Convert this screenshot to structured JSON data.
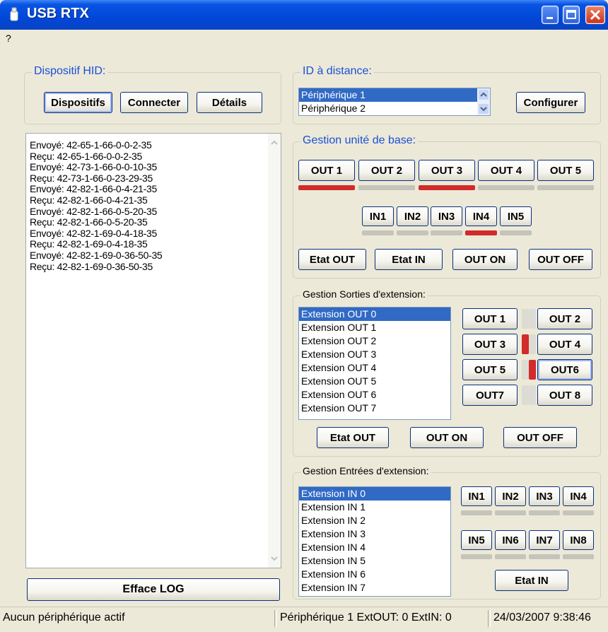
{
  "window": {
    "title": "USB RTX"
  },
  "menu": {
    "help": "?"
  },
  "hid": {
    "title": "Dispositif HID:",
    "devices_btn": "Dispositifs",
    "connect_btn": "Connecter",
    "details_btn": "Détails"
  },
  "remote": {
    "title": "ID à distance:",
    "options": [
      "Périphérique 1",
      "Périphérique 2"
    ],
    "selected": "Périphérique 1",
    "configure_btn": "Configurer"
  },
  "base": {
    "title": "Gestion unité de base:",
    "outs": [
      {
        "label": "OUT 1",
        "active": true
      },
      {
        "label": "OUT 2",
        "active": false
      },
      {
        "label": "OUT 3",
        "active": true
      },
      {
        "label": "OUT 4",
        "active": false
      },
      {
        "label": "OUT 5",
        "active": false
      }
    ],
    "ins": [
      {
        "label": "IN1",
        "active": false
      },
      {
        "label": "IN2",
        "active": false
      },
      {
        "label": "IN3",
        "active": false
      },
      {
        "label": "IN4",
        "active": true
      },
      {
        "label": "IN5",
        "active": false
      }
    ],
    "etat_out_btn": "Etat OUT",
    "etat_in_btn": "Etat IN",
    "out_on_btn": "OUT ON",
    "out_off_btn": "OUT OFF"
  },
  "ext_out": {
    "title": "Gestion Sorties d'extension:",
    "list": [
      "Extension OUT 0",
      "Extension OUT 1",
      "Extension OUT 2",
      "Extension OUT 3",
      "Extension OUT 4",
      "Extension OUT 5",
      "Extension OUT 6",
      "Extension OUT 7"
    ],
    "selected": "Extension OUT 0",
    "outs": [
      {
        "label": "OUT 1",
        "active": false
      },
      {
        "label": "OUT 2",
        "active": false
      },
      {
        "label": "OUT 3",
        "active": true
      },
      {
        "label": "OUT 4",
        "active": false
      },
      {
        "label": "OUT 5",
        "active": false
      },
      {
        "label": "OUT6",
        "active": true
      },
      {
        "label": "OUT7",
        "active": false
      },
      {
        "label": "OUT 8",
        "active": false
      }
    ],
    "etat_out_btn": "Etat OUT",
    "out_on_btn": "OUT ON",
    "out_off_btn": "OUT OFF"
  },
  "ext_in": {
    "title": "Gestion Entrées d'extension:",
    "list": [
      "Extension IN 0",
      "Extension IN 1",
      "Extension IN 2",
      "Extension IN 3",
      "Extension IN 4",
      "Extension IN 5",
      "Extension IN 6",
      "Extension IN 7"
    ],
    "selected": "Extension IN 0",
    "ins": [
      {
        "label": "IN1",
        "active": false
      },
      {
        "label": "IN2",
        "active": false
      },
      {
        "label": "IN3",
        "active": false
      },
      {
        "label": "IN4",
        "active": false
      },
      {
        "label": "IN5",
        "active": false
      },
      {
        "label": "IN6",
        "active": false
      },
      {
        "label": "IN7",
        "active": false
      },
      {
        "label": "IN8",
        "active": false
      }
    ],
    "etat_in_btn": "Etat IN"
  },
  "log": {
    "lines": [
      "Envoyé: 42-65-1-66-0-0-2-35",
      "Reçu: 42-65-1-66-0-0-2-35",
      "Envoyé: 42-73-1-66-0-0-10-35",
      "Reçu: 42-73-1-66-0-23-29-35",
      "Envoyé: 42-82-1-66-0-4-21-35",
      "Reçu: 42-82-1-66-0-4-21-35",
      "Envoyé: 42-82-1-66-0-5-20-35",
      "Reçu: 42-82-1-66-0-5-20-35",
      "Envoyé: 42-82-1-69-0-4-18-35",
      "Reçu: 42-82-1-69-0-4-18-35",
      "Envoyé: 42-82-1-69-0-36-50-35",
      "Reçu: 42-82-1-69-0-36-50-35"
    ],
    "clear_btn": "Efface LOG"
  },
  "status": {
    "left": "Aucun périphérique actif",
    "middle": "Périphérique 1 ExtOUT: 0 ExtIN: 0",
    "right": "24/03/2007 9:38:46"
  },
  "colors": {
    "titlebar": "#0047d8",
    "group_title": "#1a50d8",
    "indicator_on": "#d12b2b",
    "indicator_off": "#c4c4bb",
    "selection": "#316ac5"
  },
  "icons": [
    "app-icon",
    "minimize-icon",
    "maximize-icon",
    "close-icon",
    "scroll-up-icon",
    "scroll-down-icon"
  ]
}
